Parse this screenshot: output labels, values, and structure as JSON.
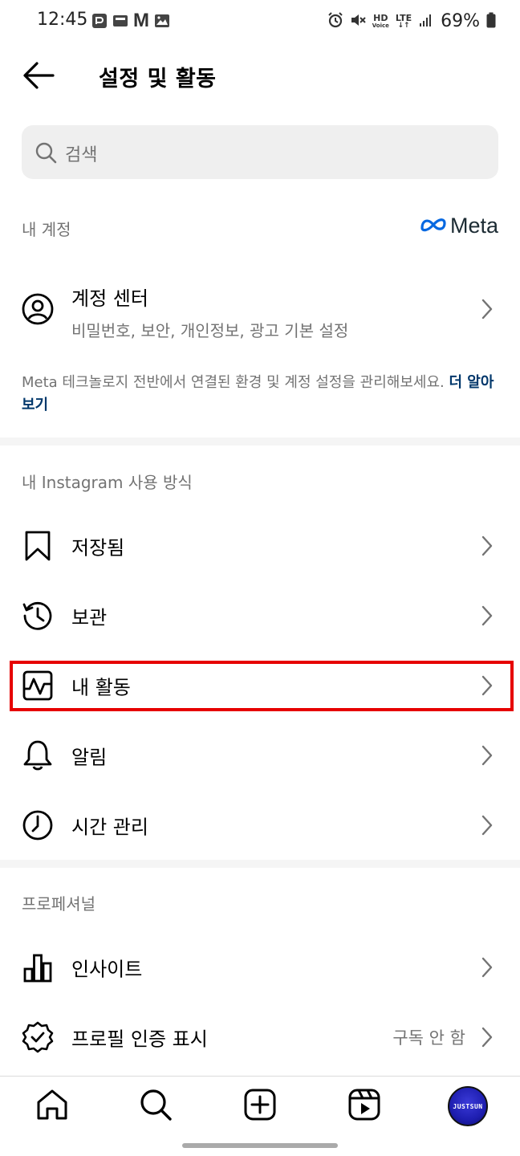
{
  "status_bar": {
    "time": "12:45",
    "left_icons": [
      "pay-icon",
      "wallet-icon",
      "gmail-icon",
      "gallery-icon"
    ],
    "gmail_letter": "M",
    "right_icons": [
      "alarm-icon",
      "mute-icon",
      "hd-voice-icon",
      "lte-icon",
      "signal-icon",
      "battery-icon"
    ],
    "hd_label": "HD",
    "voice_label": "Voice",
    "lte_label": "LTE",
    "battery": "69%"
  },
  "header": {
    "title": "설정 및 활동"
  },
  "search": {
    "placeholder": "검색"
  },
  "my_account": {
    "label": "내 계정",
    "meta_logo_text": "Meta",
    "account_center": {
      "title": "계정 센터",
      "subtitle": "비밀번호, 보안, 개인정보, 광고 기본 설정"
    },
    "note": "Meta 테크놀로지 전반에서 연결된 환경 및 계정 설정을 관리해보세요.",
    "note_link": "더 알아보기"
  },
  "how_you_use": {
    "label": "내 Instagram 사용 방식",
    "items": [
      {
        "label": "저장됨",
        "icon": "bookmark-icon"
      },
      {
        "label": "보관",
        "icon": "archive-icon"
      },
      {
        "label": "내 활동",
        "icon": "activity-icon"
      },
      {
        "label": "알림",
        "icon": "bell-icon"
      },
      {
        "label": "시간 관리",
        "icon": "clock-icon"
      }
    ]
  },
  "professional": {
    "label": "프로페셔널",
    "items": [
      {
        "label": "인사이트",
        "icon": "insights-icon"
      },
      {
        "label": "프로필 인증 표시",
        "icon": "verified-icon",
        "value": "구독 안 함"
      }
    ]
  },
  "bottom_nav": {
    "items": [
      "home-icon",
      "search-icon",
      "create-icon",
      "reels-icon",
      "profile-avatar"
    ],
    "avatar_text": "JUSTSUN"
  },
  "colors": {
    "highlight": "#e60000",
    "link": "#00376b",
    "secondary_text": "#737373",
    "meta_blue": "#0668e1"
  }
}
